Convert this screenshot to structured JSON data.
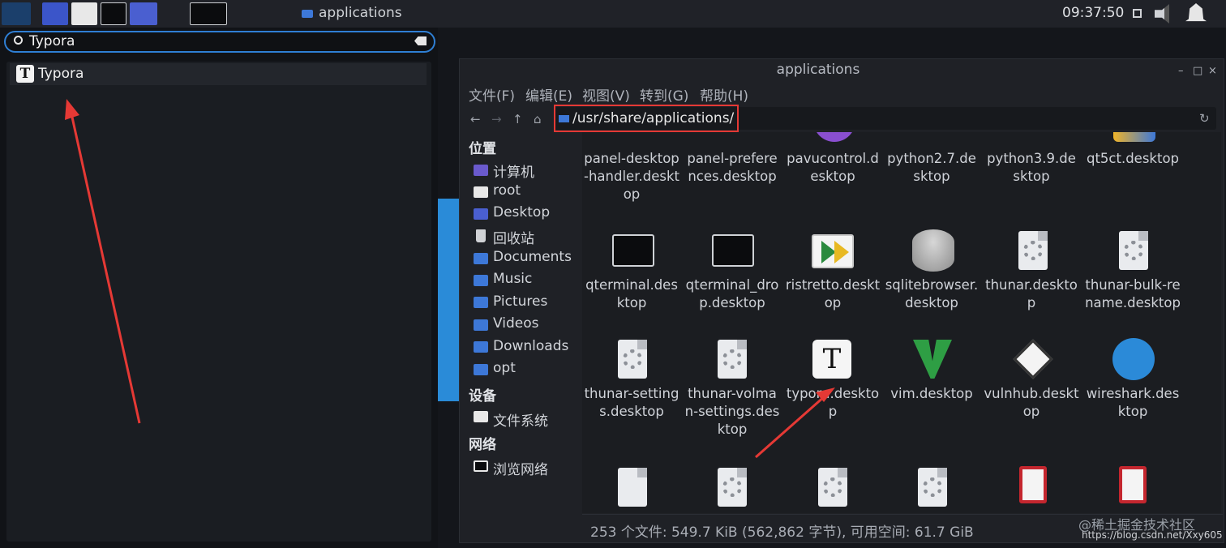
{
  "panel": {
    "app_title": "applications",
    "clock": "09:37:50"
  },
  "launcher": {
    "search_value": "Typora",
    "result_label": "Typora",
    "result_icon_letter": "T"
  },
  "window": {
    "title": "applications",
    "menu": [
      "文件(F)",
      "编辑(E)",
      "视图(V)",
      "转到(G)",
      "帮助(H)"
    ],
    "location": "/usr/share/applications/",
    "status": "253 个文件: 549.7 KiB (562,862 字节), 可用空间: 61.7 GiB"
  },
  "sidebar": {
    "places_header": "位置",
    "places": [
      "计算机",
      "root",
      "Desktop",
      "回收站",
      "Documents",
      "Music",
      "Pictures",
      "Videos",
      "Downloads",
      "opt"
    ],
    "devices_header": "设备",
    "devices": [
      "文件系统"
    ],
    "network_header": "网络",
    "network": [
      "浏览网络"
    ]
  },
  "files_row1": [
    "panel-desktop-handler.desktop",
    "panel-preferences.desktop",
    "pavucontrol.desktop",
    "python2.7.desktop",
    "python3.9.desktop",
    "qt5ct.desktop"
  ],
  "files_row2": [
    "qterminal.desktop",
    "qterminal_drop.desktop",
    "ristretto.desktop",
    "sqlitebrowser.desktop",
    "thunar.desktop",
    "thunar-bulk-rename.desktop"
  ],
  "files_row3": [
    "thunar-settings.desktop",
    "thunar-volman-settings.desktop",
    "typora.desktop",
    "vim.desktop",
    "vulnhub.desktop",
    "wireshark.desktop"
  ],
  "watermark": {
    "text": "@稀土掘金技术社区",
    "url": "https://blog.csdn.net/Xxy605"
  },
  "colors": {
    "accent": "#2f7fd4",
    "highlight": "#e53935"
  }
}
